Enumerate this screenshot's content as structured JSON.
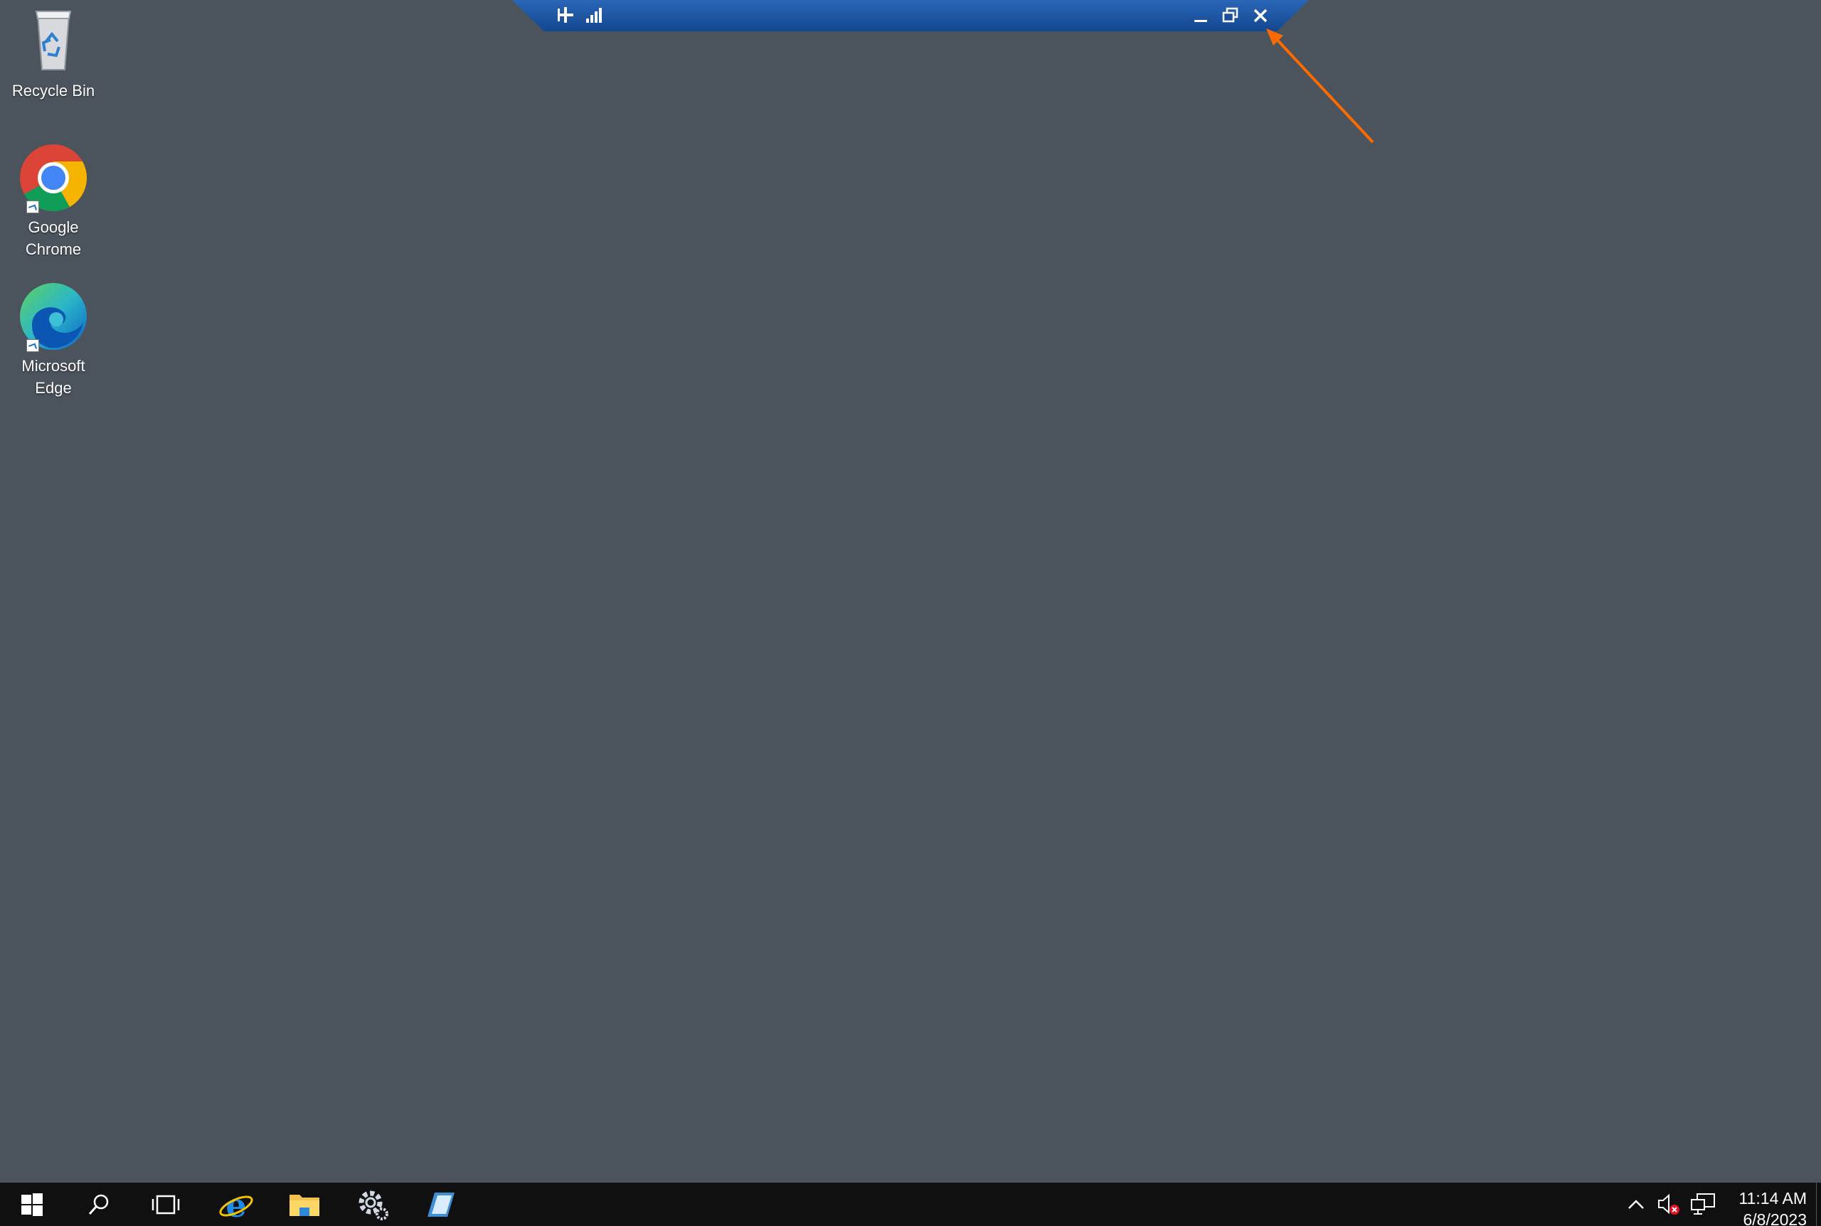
{
  "desktop": {
    "background_color": "#4b535c",
    "icons": [
      {
        "label": "Recycle Bin",
        "icon": "recycle-bin-icon"
      },
      {
        "label": "Google Chrome",
        "icon": "chrome-icon"
      },
      {
        "label": "Microsoft Edge",
        "icon": "edge-icon"
      }
    ]
  },
  "rdp_bar": {
    "icons": [
      "pin-icon",
      "signal-icon",
      "minimize-icon",
      "restore-icon",
      "close-icon"
    ],
    "color": "#1f5aa8"
  },
  "annotation": {
    "type": "arrow",
    "color": "#ff6a00",
    "target": "close-button"
  },
  "taskbar": {
    "background_color": "#101010",
    "items": [
      "start-icon",
      "search-icon",
      "task-view-icon",
      "internet-explorer-icon",
      "file-explorer-icon",
      "server-manager-icon",
      "shell-app-icon"
    ],
    "tray": [
      "chevron-up-icon",
      "volume-muted-icon",
      "network-icon"
    ],
    "clock": {
      "time": "11:14 AM",
      "date": "6/8/2023"
    }
  }
}
